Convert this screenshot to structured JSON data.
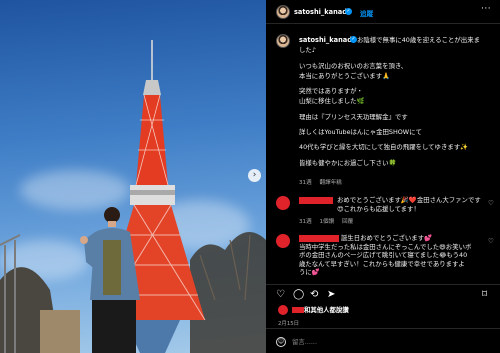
{
  "post": {
    "username": "satoshi_kanada",
    "follow_label": "追蹤",
    "more_icon": "more-options-icon",
    "next_icon": "chevron-right-icon"
  },
  "caption": {
    "username": "satoshi_kanada",
    "lines": [
      "お陰様で無事に40歳を迎えることが出来ま",
      "した♪",
      "",
      "いつも沢山のお祝いのお言葉を頂き、",
      "本当にありがとうございます🙏",
      "",
      "突然ではありますが・",
      "山梨に移住しました🌿",
      "",
      "理由は『プリンセス天功理解金』です",
      "",
      "詳しくはYouTubeはんにゃ金田SHOWにて",
      "",
      "40代も学びと縁を大切にして独自の飛躍をしてゆきます✨",
      "",
      "皆様も健やかにお過ごし下さい🍀"
    ],
    "time": "31週",
    "translate": "翻譯年糕"
  },
  "comments": [
    {
      "lines": [
        "おめでとうございます🎉❤️金田さん大ファンです",
        "😍これからも応援してます！"
      ],
      "time": "31週",
      "likes": "1個讚",
      "reply": "回覆"
    },
    {
      "lines": [
        "誕生日おめでとうございます💕",
        "当時中学生だった私は金田さんにぞっこんでした😄お笑いボ",
        "ボの金田さんのページ広げて眺引いて寝てました😂もう40",
        "歳たなんて早すぎい！これからも健康で幸せでありますよ",
        "うに💕"
      ]
    }
  ],
  "actions": {
    "like_icon": "heart-icon",
    "comment_icon": "comment-icon",
    "share_icon": "share-icon",
    "repost_icon": "send-icon",
    "save_icon": "bookmark-icon"
  },
  "likes_text": "和其他人都說讚",
  "date": "2月15日",
  "add_comment_placeholder": "留言......",
  "colors": {
    "accent": "#0095f6",
    "redaction": "#e0232a"
  }
}
